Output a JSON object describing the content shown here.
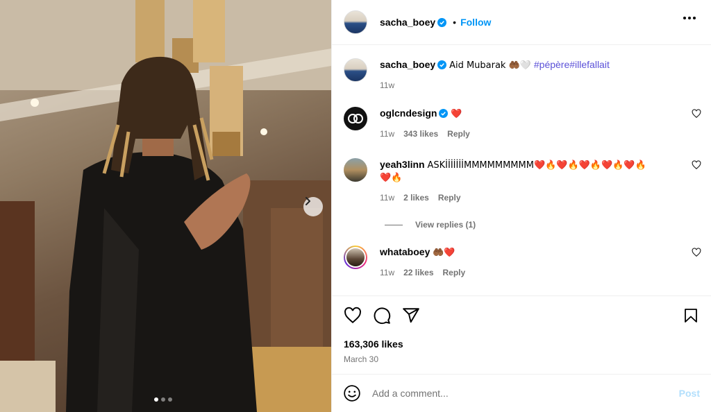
{
  "header": {
    "username": "sacha_boey",
    "separator": "•",
    "follow_label": "Follow"
  },
  "caption": {
    "username": "sacha_boey",
    "text": "Aid Mubarak 🤲🏾🤍",
    "hashtags": "#pépère#illefallait",
    "time": "11w"
  },
  "comments": [
    {
      "username": "oglcndesign",
      "text": "❤️",
      "time": "11w",
      "likes": "343 likes",
      "reply": "Reply"
    },
    {
      "username": "yeah3linn",
      "text": "ASKİİİİİİİMMMMMMMMM❤️🔥❤️🔥❤️🔥❤️🔥❤️🔥",
      "text2": "❤️🔥",
      "time": "11w",
      "likes": "2 likes",
      "reply": "Reply",
      "view_replies": "View replies (1)"
    },
    {
      "username": "whataboey",
      "text": "🤲🏾❤️",
      "time": "11w",
      "likes": "22 likes",
      "reply": "Reply"
    }
  ],
  "stats": {
    "likes": "163,306 likes",
    "date": "March 30"
  },
  "add_comment": {
    "placeholder": "Add a comment...",
    "post_label": "Post"
  },
  "icons": [
    "verified-icon",
    "more-icon",
    "heart-icon",
    "comment-icon",
    "share-icon",
    "bookmark-icon",
    "emoji-icon",
    "chevron-right-icon"
  ],
  "colors": {
    "link": "#0095f6",
    "hashtag": "#5b51d8",
    "meta": "#737373",
    "post_disabled": "#b2dffc"
  },
  "carousel": {
    "slides": 3,
    "active": 1
  }
}
